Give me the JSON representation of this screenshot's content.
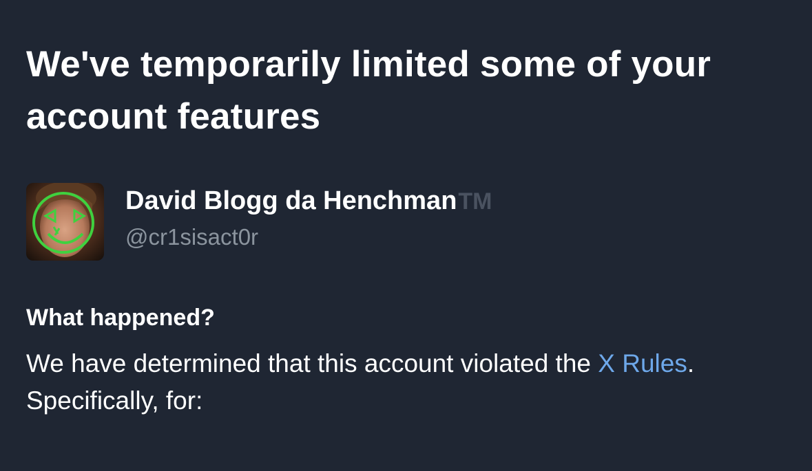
{
  "header": {
    "title": "We've temporarily limited some of your account features"
  },
  "account": {
    "display_name": "David Blogg da Henchman",
    "name_suffix": "TM",
    "handle": "@cr1sisact0r",
    "avatar_icon": "avatar-photo-with-green-smiley-overlay"
  },
  "details": {
    "heading": "What happened?",
    "text_before_link": "We have determined that this account violated the ",
    "link_text": "X Rules",
    "text_after_link": ". Specifically, for:"
  },
  "colors": {
    "background": "#1f2633",
    "text": "#ffffff",
    "secondary_text": "#8b949e",
    "link": "#6ea8ea",
    "overlay_green": "#3fd13f"
  }
}
